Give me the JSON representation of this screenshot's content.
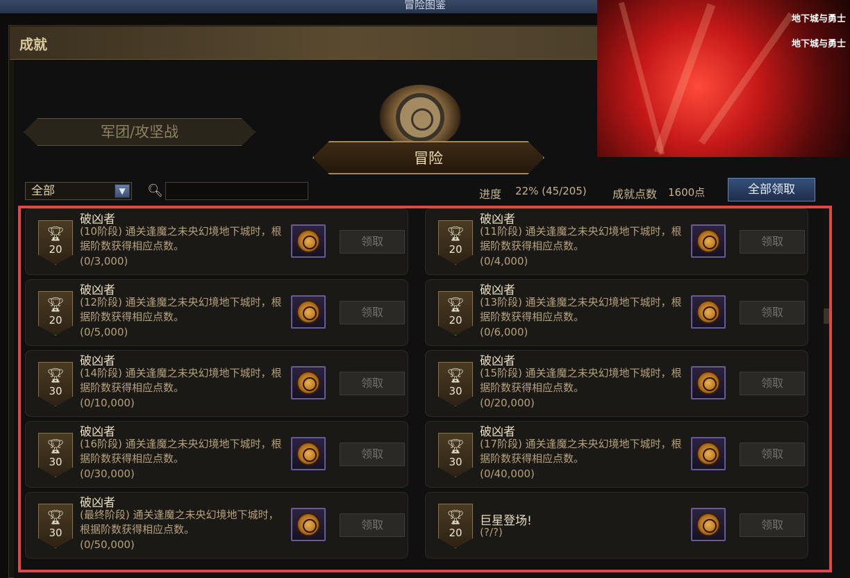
{
  "window": {
    "title": "冒险图鉴"
  },
  "section": {
    "title": "成就"
  },
  "tabs": {
    "legion": "军团/攻坚战",
    "adventure": "冒险"
  },
  "filter": {
    "selected": "全部",
    "search_value": ""
  },
  "stats": {
    "progress_label": "进度",
    "progress_value": "22% (45/205)",
    "points_label": "成就点数",
    "points_value": "1600点",
    "claim_all": "全部领取"
  },
  "hero": {
    "logo_text": "地下城与勇士"
  },
  "achievements": [
    {
      "title": "破凶者",
      "desc": "(10阶段) 通关逢魔之未央幻境地下城时，根据阶数获得相应点数。",
      "progress": "(0/3,000)",
      "points": "20",
      "claim": "领取"
    },
    {
      "title": "破凶者",
      "desc": "(11阶段) 通关逢魔之未央幻境地下城时，根据阶数获得相应点数。",
      "progress": "(0/4,000)",
      "points": "20",
      "claim": "领取"
    },
    {
      "title": "破凶者",
      "desc": "(12阶段) 通关逢魔之未央幻境地下城时，根据阶数获得相应点数。",
      "progress": "(0/5,000)",
      "points": "20",
      "claim": "领取"
    },
    {
      "title": "破凶者",
      "desc": "(13阶段) 通关逢魔之未央幻境地下城时，根据阶数获得相应点数。",
      "progress": "(0/6,000)",
      "points": "20",
      "claim": "领取"
    },
    {
      "title": "破凶者",
      "desc": "(14阶段) 通关逢魔之未央幻境地下城时，根据阶数获得相应点数。",
      "progress": "(0/10,000)",
      "points": "30",
      "claim": "领取"
    },
    {
      "title": "破凶者",
      "desc": "(15阶段) 通关逢魔之未央幻境地下城时，根据阶数获得相应点数。",
      "progress": "(0/20,000)",
      "points": "30",
      "claim": "领取"
    },
    {
      "title": "破凶者",
      "desc": "(16阶段) 通关逢魔之未央幻境地下城时，根据阶数获得相应点数。",
      "progress": "(0/30,000)",
      "points": "30",
      "claim": "领取"
    },
    {
      "title": "破凶者",
      "desc": "(17阶段) 通关逢魔之未央幻境地下城时，根据阶数获得相应点数。",
      "progress": "(0/40,000)",
      "points": "30",
      "claim": "领取"
    },
    {
      "title": "破凶者",
      "desc": "(最终阶段) 通关逢魔之未央幻境地下城时，根据阶数获得相应点数。",
      "progress": "(0/50,000)",
      "points": "30",
      "claim": "领取"
    },
    {
      "title": "巨星登场!",
      "desc": "",
      "progress": "(?/?)",
      "points": "20",
      "claim": "领取"
    }
  ],
  "icons": {
    "trophy": "trophy-icon",
    "reward": "reward-emblem-icon",
    "search": "search-icon",
    "dropdown": "chevron-down-icon"
  },
  "colors": {
    "highlight_box": "#e04848",
    "claim_all_bg": "#2a3f66"
  }
}
